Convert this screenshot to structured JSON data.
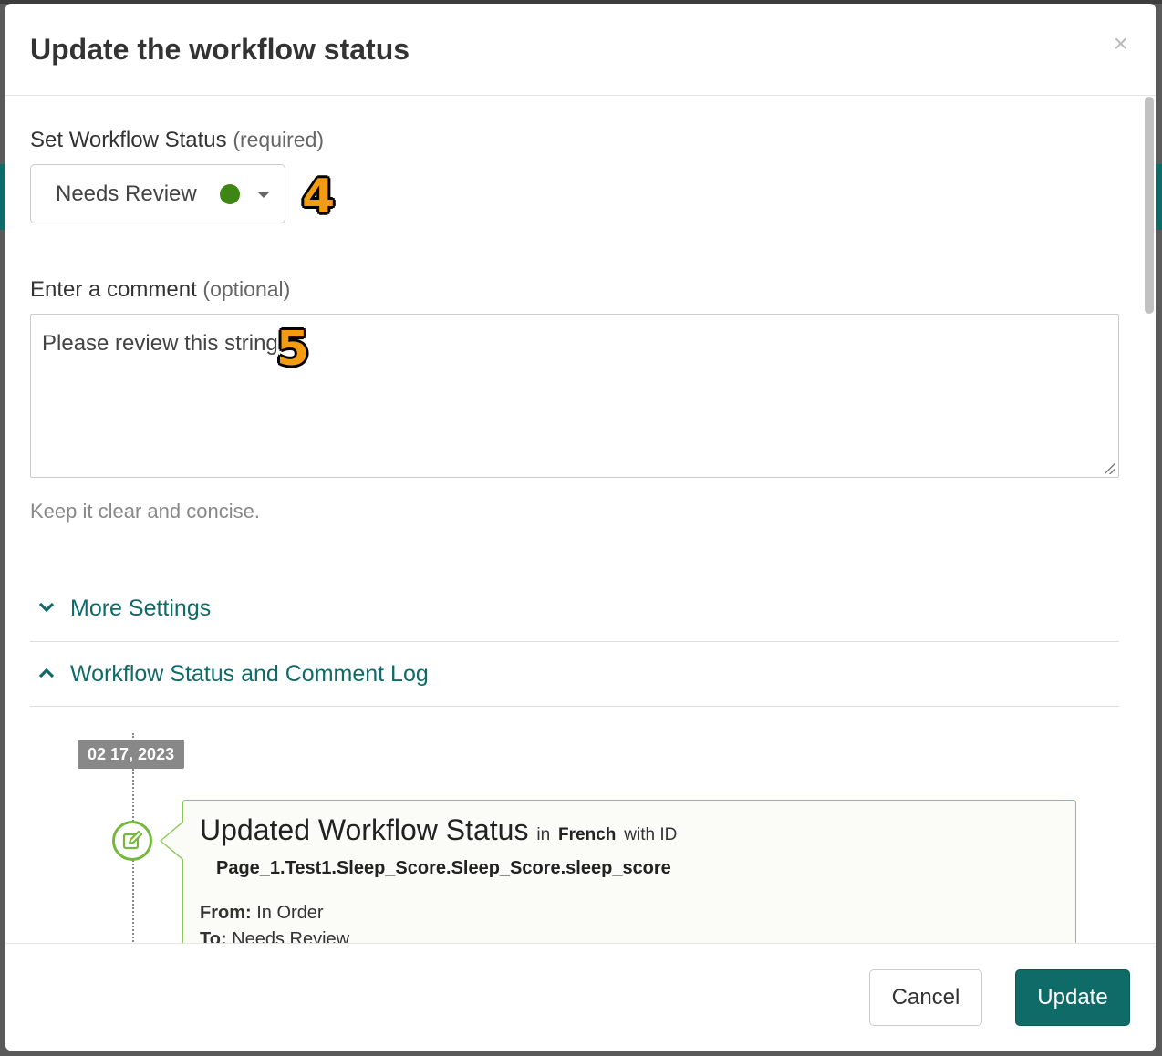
{
  "modal": {
    "title": "Update the workflow status",
    "close_label": "×"
  },
  "status_field": {
    "label": "Set Workflow Status",
    "qualifier": "(required)",
    "selected_value": "Needs Review",
    "status_color": "#3d8613",
    "callout": "4"
  },
  "comment_field": {
    "label": "Enter a comment",
    "qualifier": "(optional)",
    "value": "Please review this string",
    "callout": "5",
    "help_text": "Keep it clear and concise."
  },
  "accordion": {
    "more_settings": "More Settings",
    "log": "Workflow Status and Comment Log"
  },
  "log": {
    "date": "02 17, 2023",
    "entry_title": "Updated Workflow Status",
    "in_word": "in",
    "language": "French",
    "with_id": "with ID",
    "string_id": "Page_1.Test1.Sleep_Score.Sleep_Score.sleep_score",
    "from_label": "From:",
    "from_value": "In Order",
    "to_label": "To:",
    "to_value": "Needs Review"
  },
  "footer": {
    "cancel_label": "Cancel",
    "update_label": "Update"
  },
  "colors": {
    "accent": "#0f6b67",
    "callout": "#f39c12",
    "log_green": "#76b83c"
  }
}
